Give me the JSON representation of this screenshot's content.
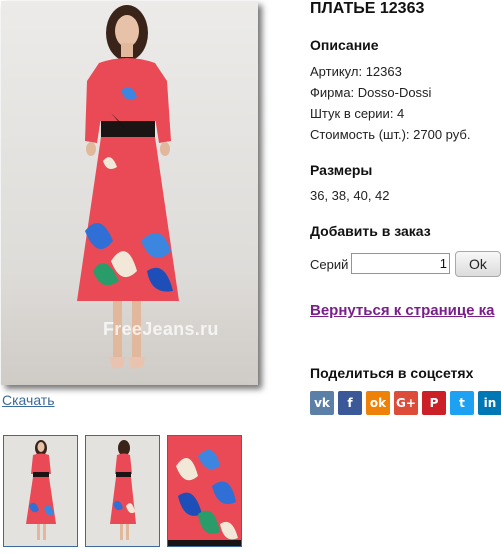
{
  "product": {
    "title": "ПЛАТЬЕ 12363",
    "watermark": "FreeJeans.ru",
    "download_label": "Скачать"
  },
  "description": {
    "heading": "Описание",
    "article": "Артикул: 12363",
    "brand": "Фирма: Dosso-Dossi",
    "per_series": "Штук в серии: 4",
    "price": "Стоимость (шт.): 2700 руб."
  },
  "sizes": {
    "heading": "Размеры",
    "values": "36, 38, 40, 42"
  },
  "order": {
    "heading": "Добавить в заказ",
    "series_label": "Серий",
    "quantity": "1",
    "ok_label": "Ok"
  },
  "back_link": "Вернуться к странице ка",
  "share": {
    "heading": "Поделиться в соцсетях",
    "buttons": [
      {
        "icon": "vk-icon",
        "glyph": "vk",
        "color": "#5b7fa6"
      },
      {
        "icon": "facebook-icon",
        "glyph": "f",
        "color": "#3b5998"
      },
      {
        "icon": "odnoklassniki-icon",
        "glyph": "ok",
        "color": "#ee8208"
      },
      {
        "icon": "google-plus-icon",
        "glyph": "G+",
        "color": "#dd4b39"
      },
      {
        "icon": "pinterest-icon",
        "glyph": "P",
        "color": "#cb2027"
      },
      {
        "icon": "twitter-icon",
        "glyph": "t",
        "color": "#1da1f2"
      },
      {
        "icon": "linkedin-icon",
        "glyph": "in",
        "color": "#0077b5"
      }
    ]
  },
  "colors": {
    "dress": "#e94a55",
    "link": "#3a6b9c",
    "back_link": "#7a1f8a"
  }
}
